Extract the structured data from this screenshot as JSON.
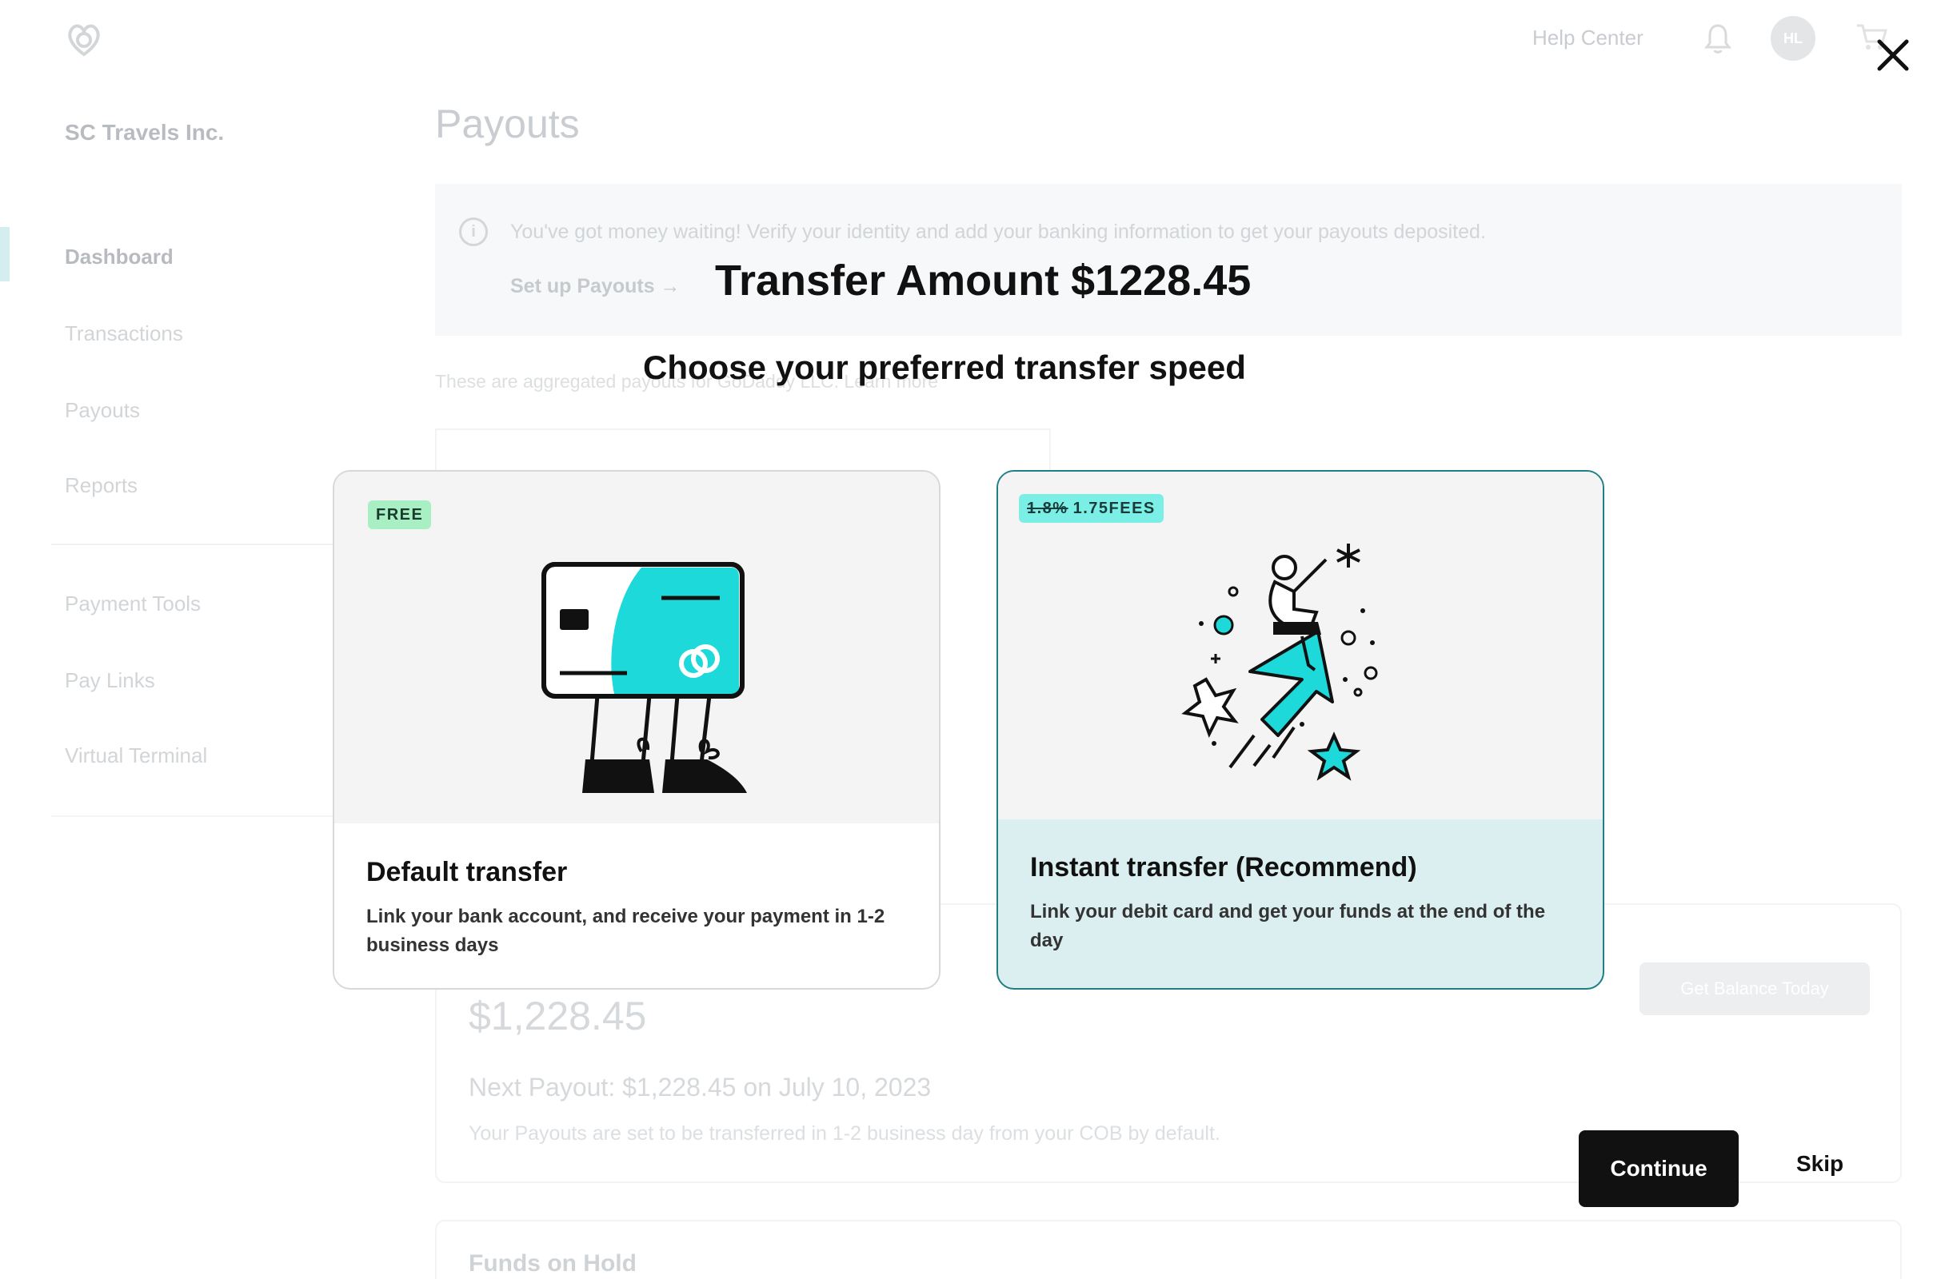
{
  "background": {
    "org_name": "SC Travels Inc.",
    "sidebar": {
      "items": [
        {
          "label": "Dashboard"
        },
        {
          "label": "Transactions"
        },
        {
          "label": "Payouts"
        },
        {
          "label": "Reports"
        },
        {
          "label": "Payment Tools"
        },
        {
          "label": "Pay Links"
        },
        {
          "label": "Virtual Terminal"
        }
      ]
    },
    "header": {
      "help_center": "Help Center",
      "avatar_initials": "HL"
    },
    "page_title": "Payouts",
    "banner": {
      "message": "You've got money waiting! Verify your identity and add your banking information to get your payouts deposited.",
      "link_label": "Set up Payouts →"
    },
    "aggregated_note": "These are aggregated payouts for GoDaddy LLC. Learn more",
    "balance": {
      "amount": "$1,228.45",
      "next_payout": "Next Payout: $1,228.45 on July 10, 2023",
      "note": "Your Payouts are set to be transferred in 1-2 business day from your COB by default.",
      "get_balance_label": "Get Balance Today"
    },
    "funds_on_hold": "Funds on Hold"
  },
  "modal": {
    "title": "Transfer Amount $1228.45",
    "subtitle": "Choose your preferred transfer speed",
    "options": [
      {
        "badge": "FREE",
        "title": "Default transfer",
        "description": "Link your bank account, and receive your payment in 1-2 business days"
      },
      {
        "badge_strike": "1.8%",
        "badge": "1.75FEES",
        "title": "Instant transfer (Recommend)",
        "description": "Link your debit card and get your funds at the end of the day"
      }
    ],
    "continue_label": "Continue",
    "skip_label": "Skip"
  },
  "colors": {
    "accent_teal": "#1ed9d9",
    "selected_border": "#1e7f86",
    "selected_bg": "#dbeff0",
    "primary_button": "#111111"
  },
  "icons": [
    "logo-icon",
    "bell-icon",
    "cart-icon",
    "close-icon",
    "info-icon"
  ]
}
